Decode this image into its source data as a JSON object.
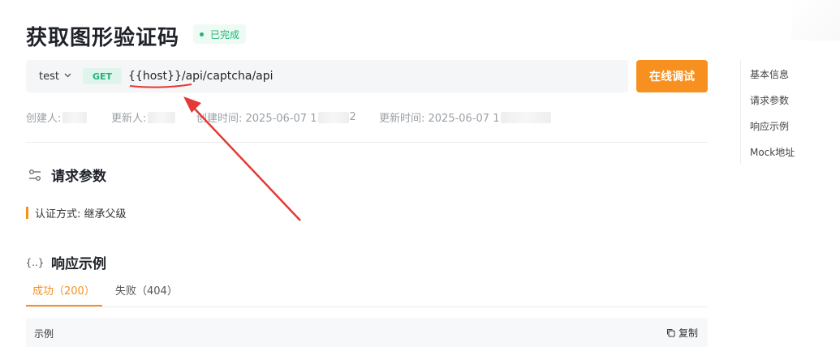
{
  "header": {
    "title": "获取图形验证码",
    "status": "已完成"
  },
  "request": {
    "environment": "test",
    "method": "GET",
    "url": "{{host}}/api/captcha/api",
    "debug_label": "在线调试"
  },
  "meta": {
    "creator_label": "创建人:",
    "updater_label": "更新人:",
    "created_label": "创建时间: 2025-06-07 1",
    "created_tail": "2",
    "updated_label": "更新时间: 2025-06-07 1"
  },
  "sections": {
    "params_title": "请求参数",
    "auth_text": "认证方式: 继承父级",
    "response_title": "响应示例",
    "response_icon_text": "{..}"
  },
  "tabs": [
    {
      "label": "成功（200）"
    },
    {
      "label": "失败（404）"
    }
  ],
  "example": {
    "label": "示例",
    "copy_label": "复制"
  },
  "toc": {
    "items": [
      "基本信息",
      "请求参数",
      "响应示例",
      "Mock地址"
    ]
  },
  "colors": {
    "accent": "#f7901e",
    "success": "#22b573",
    "method": "#23b07d",
    "annotation": "#e53935"
  }
}
